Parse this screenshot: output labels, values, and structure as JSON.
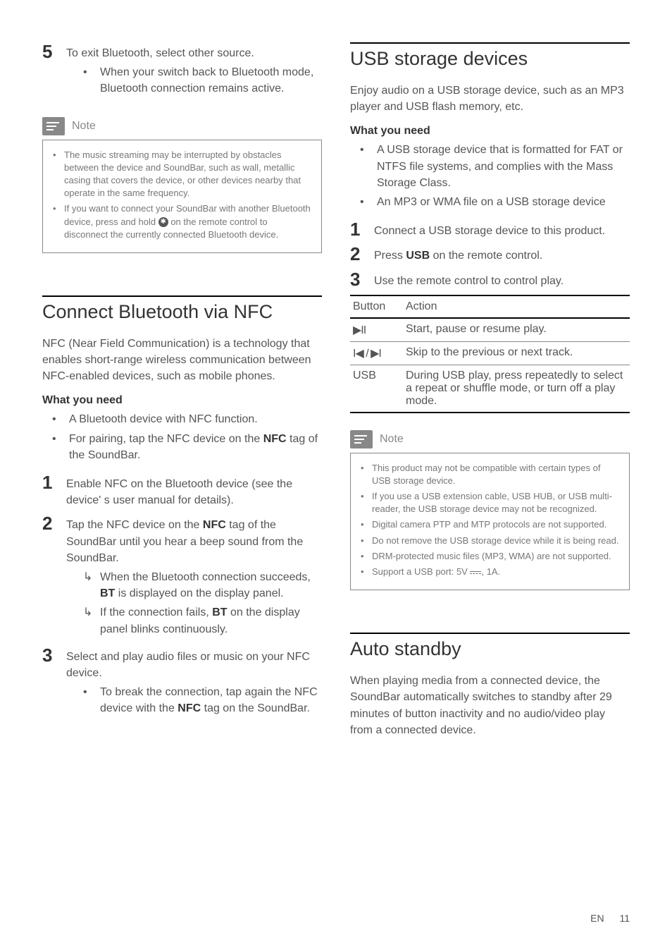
{
  "left": {
    "step5": {
      "num": "5",
      "text": "To exit Bluetooth, select other source.",
      "sub": "When your switch back to Bluetooth mode, Bluetooth connection remains active."
    },
    "note1": {
      "title": "Note",
      "items": [
        "The music streaming may be interrupted by obstacles between the device and SoundBar, such as wall, metallic casing that covers the device, or other devices nearby that operate in the same frequency.",
        "If you want to connect your SoundBar with another Bluetooth device, press and hold "
      ],
      "item2_tail": " on the remote control to disconnect the currently connected Bluetooth device."
    },
    "nfc": {
      "title": "Connect Bluetooth via NFC",
      "intro": "NFC (Near Field Communication) is a technology that enables short-range wireless communication between NFC-enabled devices, such as mobile phones.",
      "need_label": "What you need",
      "need1": "A Bluetooth device with NFC function.",
      "need2_a": "For pairing, tap the NFC device on the ",
      "need2_b": "NFC",
      "need2_c": " tag of the SoundBar.",
      "s1": {
        "num": "1",
        "text": "Enable NFC on the Bluetooth device (see the device' s user manual for details)."
      },
      "s2": {
        "num": "2",
        "text_a": "Tap the NFC device on the ",
        "text_b": "NFC",
        "text_c": " tag of the SoundBar until you hear a beep sound from the SoundBar.",
        "r1_a": "When the Bluetooth connection succeeds, ",
        "r1_b": "BT",
        "r1_c": " is displayed on the display panel.",
        "r2_a": "If the connection fails, ",
        "r2_b": "BT",
        "r2_c": " on the display panel blinks continuously."
      },
      "s3": {
        "num": "3",
        "text": "Select and play audio files or music on your NFC device.",
        "sub_a": "To break the connection, tap again the NFC device with the ",
        "sub_b": "NFC",
        "sub_c": " tag on the SoundBar."
      }
    }
  },
  "right": {
    "usb": {
      "title": "USB storage devices",
      "intro": "Enjoy audio on a USB storage device, such as an MP3 player and USB flash memory, etc.",
      "need_label": "What you need",
      "need1": "A USB storage device that is formatted for FAT or NTFS file systems, and complies with the Mass Storage Class.",
      "need2": "An MP3 or WMA file on a USB storage device",
      "s1": {
        "num": "1",
        "text": "Connect a USB storage device to this product."
      },
      "s2": {
        "num": "2",
        "text_a": "Press ",
        "text_b": "USB",
        "text_c": " on the remote control."
      },
      "s3": {
        "num": "3",
        "text": "Use the remote control to control play."
      }
    },
    "table": {
      "h1": "Button",
      "h2": "Action",
      "r1b": "▶II",
      "r1a": "Start, pause or resume play.",
      "r2b": "I◀ / ▶I",
      "r2a": "Skip to the previous or next track.",
      "r3b": "USB",
      "r3a": "During USB play, press repeatedly to select a repeat or shuffle mode, or turn off a play mode."
    },
    "note2": {
      "title": "Note",
      "items": [
        "This product may not be compatible with certain types of USB storage device.",
        "If you use a USB extension cable, USB HUB, or USB multi-reader, the USB storage device may not be recognized.",
        "Digital camera PTP and MTP protocols are not supported.",
        "Do not remove the USB storage device while it is being read.",
        "DRM-protected music files (MP3, WMA) are not supported."
      ],
      "item6_a": "Support a USB port: 5V ",
      "item6_b": ", 1A."
    },
    "auto": {
      "title": "Auto standby",
      "text": "When playing media from a connected device, the SoundBar automatically switches to standby after 29 minutes of button inactivity and no audio/video play from a connected device."
    }
  },
  "chart_data": {
    "type": "table",
    "title": "USB Button Actions",
    "columns": [
      "Button",
      "Action"
    ],
    "rows": [
      [
        "▶II",
        "Start, pause or resume play."
      ],
      [
        "I◀ / ▶I",
        "Skip to the previous or next track."
      ],
      [
        "USB",
        "During USB play, press repeatedly to select a repeat or shuffle mode, or turn off a play mode."
      ]
    ]
  },
  "footer": {
    "lang": "EN",
    "page": "11"
  }
}
